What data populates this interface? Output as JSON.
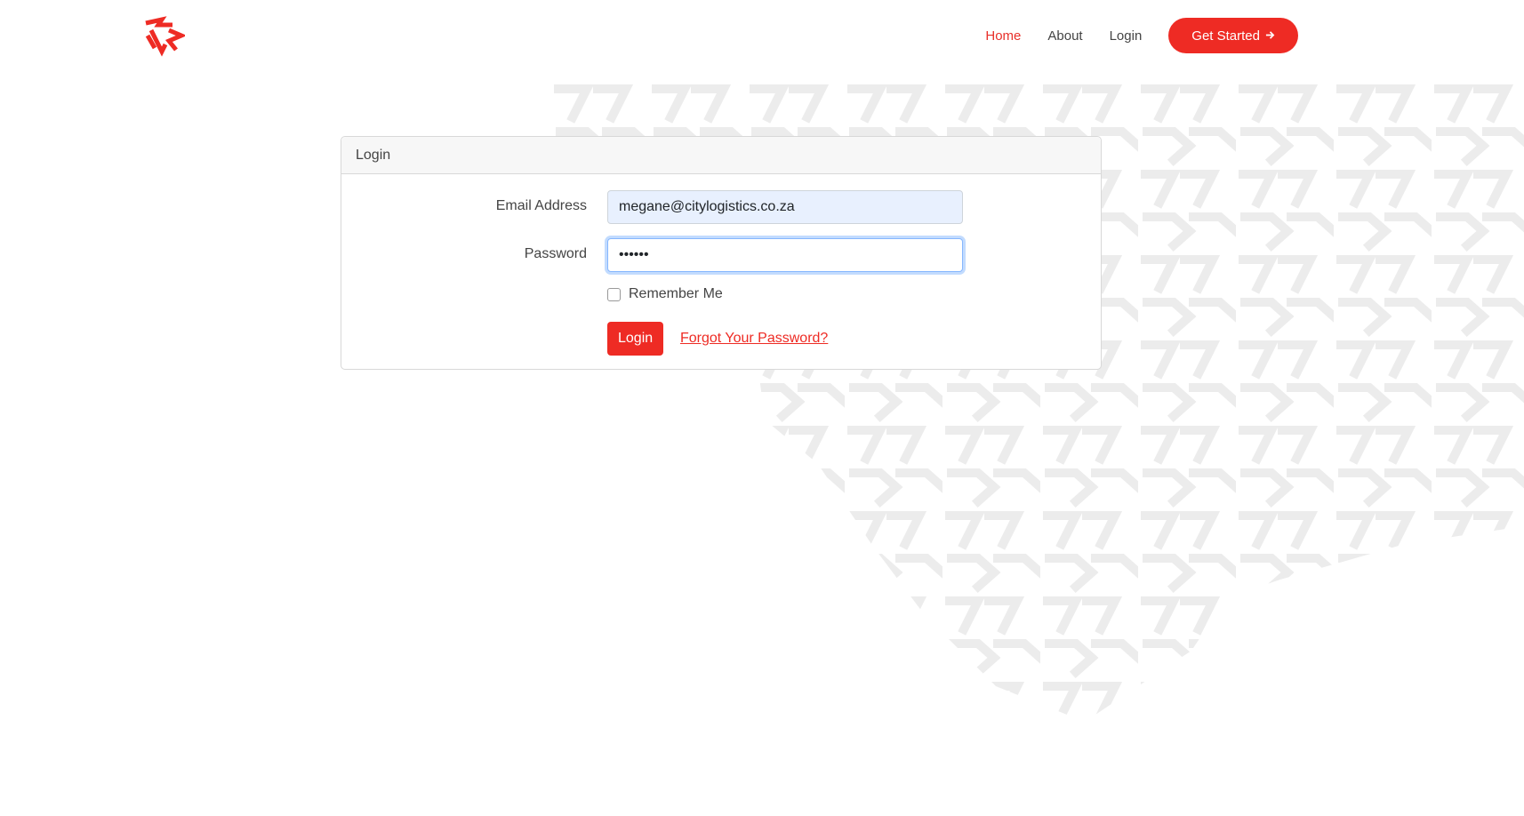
{
  "nav": {
    "links": [
      "Home",
      "About",
      "Login"
    ],
    "cta_label": "Get Started",
    "cta_icon": "arrow-right-icon"
  },
  "card": {
    "header": "Login",
    "email_label": "Email Address",
    "email_value": "megane@citylogistics.co.za",
    "password_label": "Password",
    "password_value": "••••••",
    "remember_label": "Remember Me",
    "login_label": "Login",
    "forgot_label": "Forgot Your Password?"
  },
  "colors": {
    "brand": "#ee2b24",
    "pattern": "#efefef"
  },
  "icons": {
    "logo": "brand-logo-icon"
  }
}
